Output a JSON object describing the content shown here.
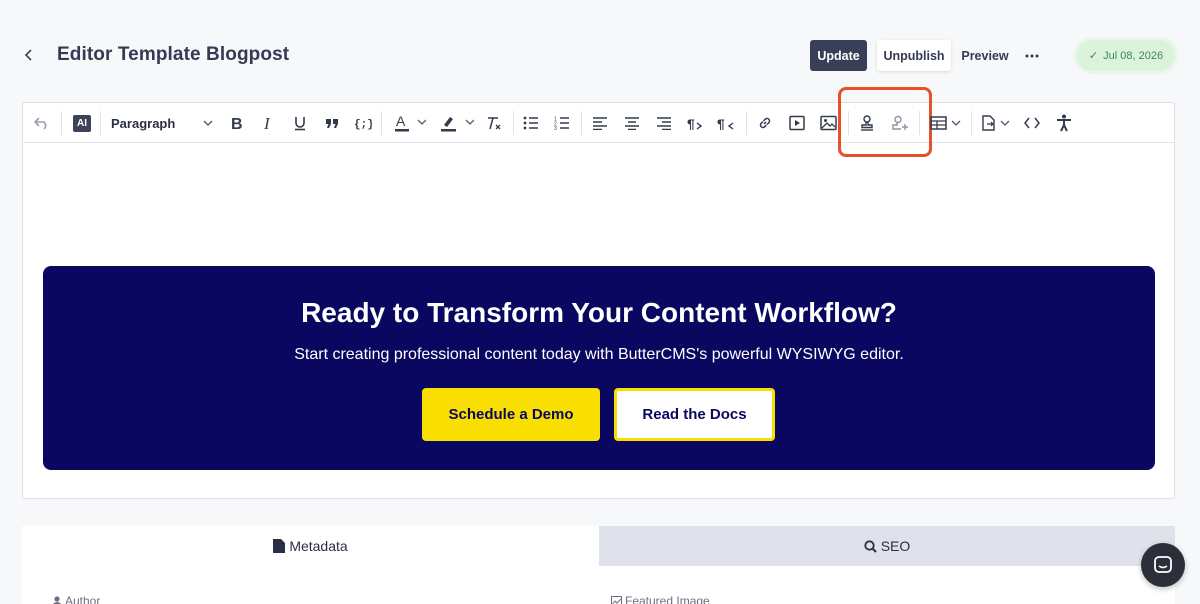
{
  "header": {
    "title": "Editor Template Blogpost",
    "update_label": "Update",
    "unpublish_label": "Unpublish",
    "preview_label": "Preview",
    "published_date": "Jul 08, 2026"
  },
  "toolbar": {
    "ai_label": "AI",
    "block_format": "Paragraph"
  },
  "cta": {
    "title": "Ready to Transform Your Content Workflow?",
    "subtitle": "Start creating professional content today with ButterCMS's powerful WYSIWYG editor.",
    "primary_button": "Schedule a Demo",
    "secondary_button": "Read the Docs"
  },
  "tabs": [
    {
      "label": "Metadata",
      "icon": "file-icon",
      "active": true
    },
    {
      "label": "SEO",
      "icon": "search-icon",
      "active": false
    }
  ],
  "fields": {
    "author_label": "Author",
    "featured_image_label": "Featured Image"
  },
  "colors": {
    "cta_background": "#0a0760",
    "cta_button": "#f8df00",
    "highlight": "#e3522d",
    "update_button": "#3a3f58",
    "date_badge": "#dbf2dd"
  }
}
